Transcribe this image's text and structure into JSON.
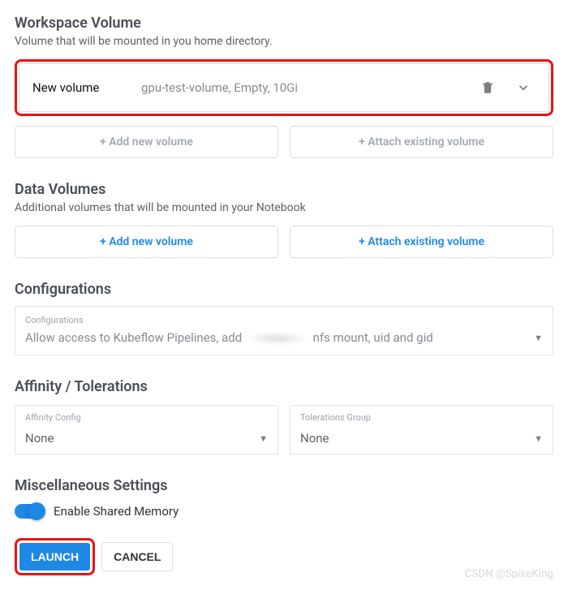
{
  "workspace": {
    "title": "Workspace Volume",
    "desc": "Volume that will be mounted in you home directory.",
    "row": {
      "label": "New volume",
      "detail": "gpu-test-volume, Empty, 10Gi"
    },
    "add_label": "+ Add new volume",
    "attach_label": "+ Attach existing volume"
  },
  "data_volumes": {
    "title": "Data Volumes",
    "desc": "Additional volumes that will be mounted in your Notebook",
    "add_label": "+ Add new volume",
    "attach_label": "+ Attach existing volume"
  },
  "configurations": {
    "title": "Configurations",
    "field_label": "Configurations",
    "value_prefix": "Allow access to Kubeflow Pipelines, add",
    "value_suffix": "nfs mount, uid and gid"
  },
  "affinity": {
    "title": "Affinity / Tolerations",
    "affinity_label": "Affinity Config",
    "affinity_value": "None",
    "tolerations_label": "Tolerations Group",
    "tolerations_value": "None"
  },
  "misc": {
    "title": "Miscellaneous Settings",
    "toggle_label": "Enable Shared Memory",
    "toggle_on": true
  },
  "footer": {
    "launch": "LAUNCH",
    "cancel": "CANCEL"
  },
  "watermark": "CSDN @SpikeKing"
}
